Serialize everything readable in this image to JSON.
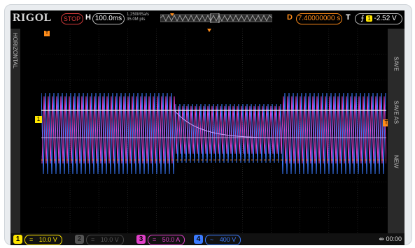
{
  "topbar": {
    "brand": "RIGOL",
    "run_state": "STOP",
    "horizontal_label": "H",
    "timebase": "100.0ms",
    "sample_rate": "1.250MSa/s",
    "memory_depth": "35.0M pts",
    "delay_label": "D",
    "delay_value": "7.40000000 s",
    "trigger_label": "T",
    "trigger_level": "-2.52 V",
    "trigger_channel": "1"
  },
  "left_panel": {
    "label": "HORIZONTAL"
  },
  "right_menu": [
    "SAVE",
    "SAVE AS",
    "NEW"
  ],
  "markers": {
    "ch1": "1",
    "trigger": "T",
    "top": "T"
  },
  "channels": [
    {
      "num": "1",
      "coupling": "=",
      "scale": "10.0 V",
      "color": "#ffe600",
      "active": true
    },
    {
      "num": "2",
      "coupling": "=",
      "scale": "10.0 V",
      "color": "#555555",
      "active": false
    },
    {
      "num": "3",
      "coupling": "=",
      "scale": "50.0 A",
      "color": "#e040c8",
      "active": true
    },
    {
      "num": "4",
      "coupling": "~",
      "scale": "400 V",
      "color": "#3b7bff",
      "active": true
    }
  ],
  "status": {
    "time": "00:00"
  },
  "colors": {
    "ch1": "#ffe600",
    "ch3": "#e040c8",
    "ch4": "#3b7bff",
    "trigger": "#ff8c1a"
  }
}
